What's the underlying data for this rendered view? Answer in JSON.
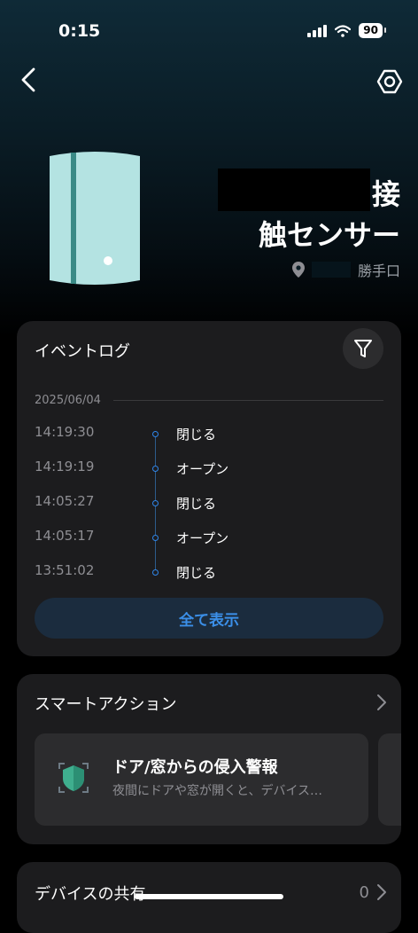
{
  "status": {
    "time": "0:15",
    "battery": "90"
  },
  "device": {
    "name_line1": "接",
    "name_line2": "触センサー",
    "location": "勝手口"
  },
  "event_log": {
    "title": "イベントログ",
    "date": "2025/06/04",
    "events": [
      {
        "time": "14:19:30",
        "label": "閉じる"
      },
      {
        "time": "14:19:19",
        "label": "オープン"
      },
      {
        "time": "14:05:27",
        "label": "閉じる"
      },
      {
        "time": "14:05:17",
        "label": "オープン"
      },
      {
        "time": "13:51:02",
        "label": "閉じる"
      }
    ],
    "show_all": "全て表示"
  },
  "smart_actions": {
    "title": "スマートアクション",
    "items": [
      {
        "title": "ドア/窓からの侵入警報",
        "desc": "夜間にドアや窓が開くと、デバイス…"
      }
    ]
  },
  "device_share": {
    "title": "デバイスの共有",
    "count": "0"
  },
  "colors": {
    "accent": "#3b8fe8",
    "card_bg": "#1c1c1e",
    "device_body": "#b4e3e2"
  }
}
